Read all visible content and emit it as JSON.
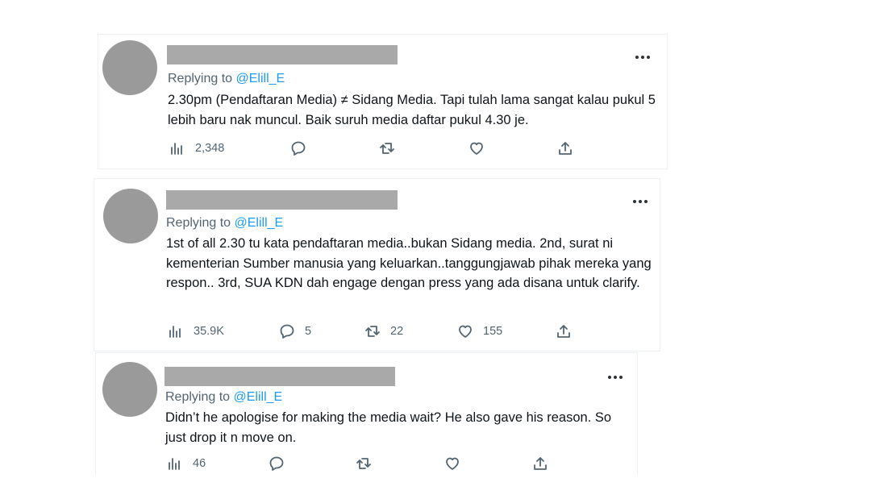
{
  "tweets": [
    {
      "replying_prefix": "Replying to",
      "replying_handle": "@Elill_E",
      "text": "2.30pm (Pendaftaran Media) ≠ Sidang Media. Tapi tulah lama sangat kalau pukul 5 lebih baru nak muncul. Baik suruh media daftar pukul 4.30 je.",
      "views": "2,348",
      "replies": "",
      "retweets": "",
      "likes": ""
    },
    {
      "replying_prefix": "Replying to",
      "replying_handle": "@Elill_E",
      "text": "1st of all 2.30 tu kata pendaftaran media..bukan Sidang media. 2nd, surat ni kementerian Sumber manusia yang keluarkan..tanggungjawab pihak mereka yang respon.. 3rd, SUA KDN dah engage dengan press yang ada disana untuk clarify.",
      "views": "35.9K",
      "replies": "5",
      "retweets": "22",
      "likes": "155"
    },
    {
      "replying_prefix": "Replying to",
      "replying_handle": "@Elill_E",
      "text": "Didn’t he apologise for making the media wait? He also gave his reason. So just drop it n move on.",
      "views": "46",
      "replies": "",
      "retweets": "",
      "likes": ""
    }
  ],
  "icons": [
    "avatar",
    "more-icon",
    "views-icon",
    "reply-icon",
    "retweet-icon",
    "like-icon",
    "share-icon"
  ],
  "colors": {
    "link": "#1d9bf0",
    "secondary_text": "#536471",
    "redaction": "#a9a9a9"
  }
}
